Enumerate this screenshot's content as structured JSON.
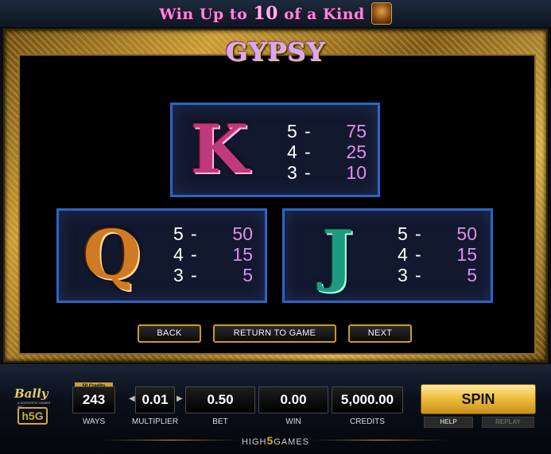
{
  "banner": {
    "prefix": "Win Up to ",
    "number": "10",
    "suffix": " of a Kind"
  },
  "paytable": {
    "title": "GYPSY",
    "symbols": [
      {
        "symbol": "K",
        "color": "#c0397a",
        "pays": [
          {
            "count": "5",
            "dash": "-",
            "amount": "75"
          },
          {
            "count": "4",
            "dash": "-",
            "amount": "25"
          },
          {
            "count": "3",
            "dash": "-",
            "amount": "10"
          }
        ]
      },
      {
        "symbol": "Q",
        "color": "#d07a24",
        "pays": [
          {
            "count": "5",
            "dash": "-",
            "amount": "50"
          },
          {
            "count": "4",
            "dash": "-",
            "amount": "15"
          },
          {
            "count": "3",
            "dash": "-",
            "amount": "5"
          }
        ]
      },
      {
        "symbol": "J",
        "color": "#1f9a82",
        "pays": [
          {
            "count": "5",
            "dash": "-",
            "amount": "50"
          },
          {
            "count": "4",
            "dash": "-",
            "amount": "15"
          },
          {
            "count": "3",
            "dash": "-",
            "amount": "5"
          }
        ]
      }
    ]
  },
  "nav": {
    "back": "BACK",
    "return": "RETURN TO GAME",
    "next": "NEXT"
  },
  "branding": {
    "bally": "Bally",
    "bally_small": "A SCIENTIFIC GAMES INC.",
    "h5g": "h5G",
    "footer_left": "HIGH",
    "footer_five": "5",
    "footer_right": "GAMES"
  },
  "controls": {
    "credits_tag": "50 Credits",
    "ways": {
      "value": "243",
      "label": "WAYS"
    },
    "multiplier": {
      "value": "0.01",
      "label": "MULTIPLIER"
    },
    "bet": {
      "value": "0.50",
      "label": "BET"
    },
    "win": {
      "value": "0.00",
      "label": "WIN"
    },
    "credits": {
      "value": "5,000.00",
      "label": "CREDITS"
    },
    "spin": "SPIN",
    "help": "HELP",
    "replay": "REPLAY"
  },
  "colors": {
    "gold": "#c9a030",
    "box_border": "#2e63c8",
    "pay_amount": "#e08ee8",
    "banner_text": "#f48ad6"
  }
}
